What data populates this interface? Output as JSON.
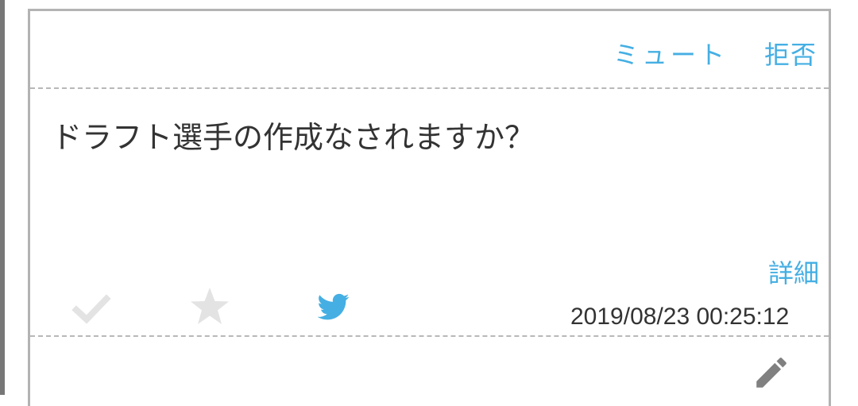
{
  "card": {
    "mute_label": "ミュート",
    "reject_label": "拒否",
    "message": "ドラフト選手の作成なされますか？",
    "detail_label": "詳細",
    "timestamp": "2019/08/23 00:25:12"
  },
  "icons": {
    "check": "check-icon",
    "star": "star-icon",
    "twitter": "twitter-icon",
    "edit": "pencil-icon"
  },
  "colors": {
    "accent": "#45afe3",
    "icon_inactive": "#e3e3e3",
    "pencil": "#808080",
    "text": "#333333",
    "border": "#b3b3b3"
  }
}
